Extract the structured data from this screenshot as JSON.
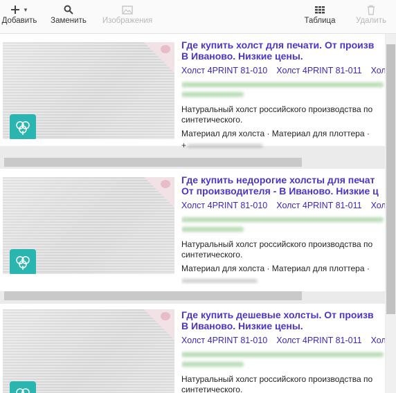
{
  "toolbar": {
    "add_label": "Добавить",
    "replace_label": "Заменить",
    "images_label": "Изображения",
    "table_label": "Таблица",
    "delete_label": "Удалить"
  },
  "cards": [
    {
      "title_1": "Где купить холст для печати. От произв",
      "title_2": "В Иваново. Низкие цены.",
      "sitelinks": [
        "Холст 4PRINT 81-010",
        "Холст 4PRINT 81-011",
        "Хол"
      ],
      "desc_1": "Натуральный холст российского производства по",
      "desc_2": "синтетического.",
      "cats": "Материал для холста · Материал для плоттера ·",
      "phone_partial": "+"
    },
    {
      "title_1": "Где купить недорогие холсты для печат",
      "title_2": "От производителя - В Иваново. Низкие ц",
      "sitelinks": [
        "Холст 4PRINT 81-010",
        "Холст 4PRINT 81-011",
        "Хол"
      ],
      "desc_1": "Натуральный холст российского производства по",
      "desc_2": "синтетического.",
      "cats": "Материал для холста · Материал для плоттера ·",
      "phone_partial": ""
    },
    {
      "title_1": "Где купить дешевые холсты. От произв",
      "title_2": "В Иваново. Низкие цены.",
      "sitelinks": [
        "Холст 4PRINT 81-010",
        "Холст 4PRINT 81-011",
        "Хол"
      ],
      "desc_1": "Натуральный холст российского производства по",
      "desc_2": "синтетического.",
      "cats": "",
      "phone_partial": ""
    }
  ],
  "colors": {
    "title": "#4a35c9",
    "sitelink": "#3a28b8",
    "logo": "#2bb5b0"
  }
}
